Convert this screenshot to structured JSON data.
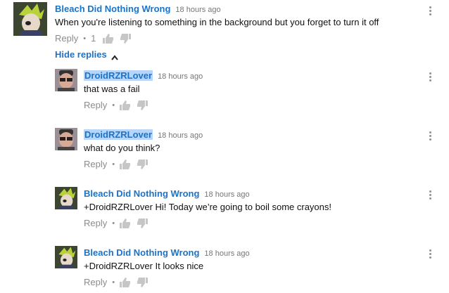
{
  "comments": [
    {
      "author": "Bleach Did Nothing Wrong",
      "time": "18 hours ago",
      "text": "When you're listening to something in the background but you forget to turn it off",
      "reply": "Reply",
      "likes": "1"
    },
    {
      "author": "DroidRZRLover",
      "time": "18 hours ago",
      "text": "that was a fail",
      "reply": "Reply"
    },
    {
      "author": "DroidRZRLover",
      "time": "18 hours ago",
      "text": "what do you think?",
      "reply": "Reply"
    },
    {
      "author": "Bleach Did Nothing Wrong",
      "time": "18 hours ago",
      "text": "+DroidRZRLover Hi! Today we’re going to boil some crayons!",
      "reply": "Reply"
    },
    {
      "author": "Bleach Did Nothing Wrong",
      "time": "18 hours ago",
      "text": "+DroidRZRLover It looks nice",
      "reply": "Reply"
    }
  ],
  "hide_replies": {
    "label": "Hide replies"
  },
  "icons": {
    "like": "thumbs-up-icon",
    "dislike": "thumbs-down-icon",
    "menu": "vertical-dots-icon",
    "chevron": "chevron-up-icon"
  },
  "colors": {
    "author": "#1a73c9",
    "highlight": "#b6d5fb",
    "muted": "#8c8c8c"
  }
}
